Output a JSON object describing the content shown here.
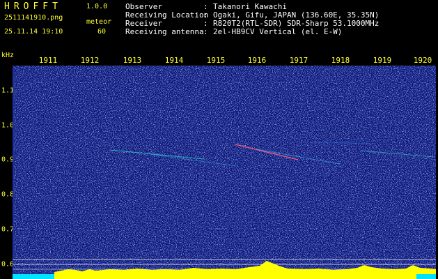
{
  "app": {
    "title": "HROFFT",
    "version": "1.0.0"
  },
  "file": {
    "name": "2511141910.png",
    "datetime": "25.11.14 19:10"
  },
  "meteor": {
    "label": "meteor",
    "count": "60"
  },
  "info": [
    {
      "key": "Observer",
      "value": "Takanori Kawachi"
    },
    {
      "key": "Receiving Location",
      "value": "Ogaki, Gifu, JAPAN (136.60E, 35.35N)"
    },
    {
      "key": "Receiver",
      "value": "R820T2(RTL-SDR) SDR-Sharp 53.1000MHz"
    },
    {
      "key": "Receiving antenna",
      "value": "2el-HB9CV Vertical (el. E-W)"
    }
  ],
  "axes": {
    "y_unit": "kHz",
    "x_ticks": [
      "1911",
      "1912",
      "1913",
      "1914",
      "1915",
      "1916",
      "1917",
      "1918",
      "1919",
      "1920"
    ],
    "y_ticks": [
      "1.1",
      "1.0",
      "0.9",
      "0.8",
      "0.7",
      "0.6"
    ]
  },
  "colors": {
    "label": "#ffff33",
    "background": "#000000",
    "spectrum_bg": "#0c1478",
    "signal": "#ffff00",
    "level": "#00e0ff"
  }
}
